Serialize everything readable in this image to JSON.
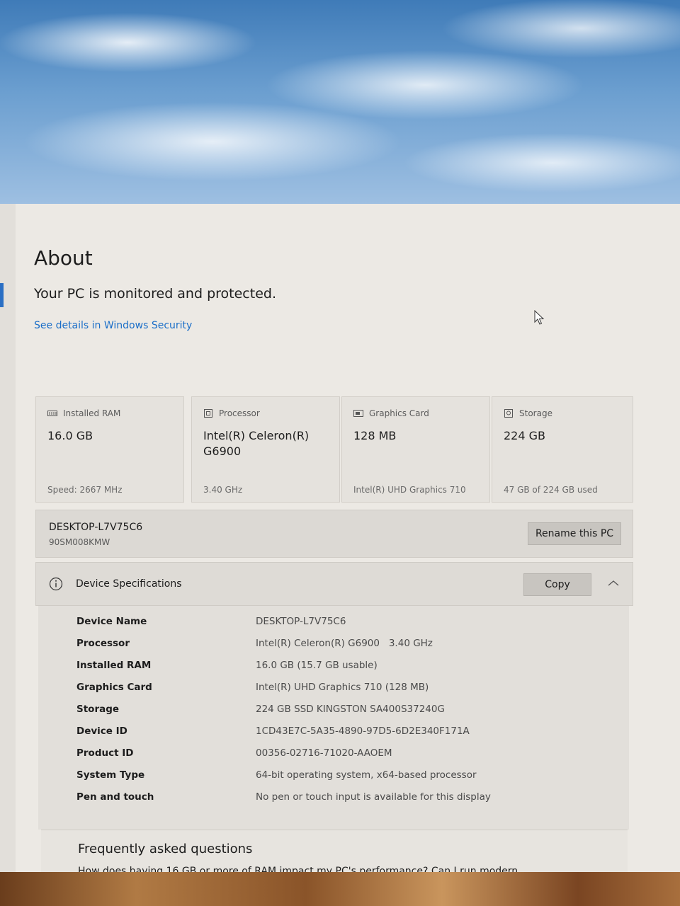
{
  "page": {
    "title": "About",
    "protection_status": "Your PC is monitored and protected.",
    "security_link": "See details in Windows Security"
  },
  "tiles": [
    {
      "label": "Installed RAM",
      "value": "16.0 GB",
      "footer": "Speed: 2667 MHz",
      "icon": "ram-icon"
    },
    {
      "label": "Processor",
      "value": "Intel(R) Celeron(R) G6900",
      "footer": "3.40 GHz",
      "icon": "processor-icon"
    },
    {
      "label": "Graphics Card",
      "value": "128 MB",
      "footer": "Intel(R) UHD Graphics 710",
      "icon": "graphics-card-icon"
    },
    {
      "label": "Storage",
      "value": "224 GB",
      "footer": "47 GB of 224 GB used",
      "icon": "storage-icon"
    }
  ],
  "pc": {
    "name": "DESKTOP-L7V75C6",
    "model": "90SM008KMW",
    "rename_label": "Rename this PC"
  },
  "specs": {
    "title": "Device Specifications",
    "copy_label": "Copy",
    "rows": [
      {
        "label": "Device Name",
        "value": "DESKTOP-L7V75C6"
      },
      {
        "label": "Processor",
        "value": "Intel(R) Celeron(R) G6900   3.40 GHz"
      },
      {
        "label": "Installed RAM",
        "value": "16.0 GB (15.7 GB usable)"
      },
      {
        "label": "Graphics Card",
        "value": "Intel(R) UHD Graphics 710 (128 MB)"
      },
      {
        "label": "Storage",
        "value": "224 GB SSD KINGSTON SA400S37240G"
      },
      {
        "label": "Device ID",
        "value": "1CD43E7C-5A35-4890-97D5-6D2E340F171A"
      },
      {
        "label": "Product ID",
        "value": "00356-02716-71020-AAOEM"
      },
      {
        "label": "System Type",
        "value": "64-bit operating system, x64-based processor"
      },
      {
        "label": "Pen and touch",
        "value": "No pen or touch input is available for this display"
      }
    ]
  },
  "faq": {
    "title": "Frequently asked questions",
    "question": "How does having 16 GB or more of RAM impact my PC's performance? Can I run modern"
  },
  "colors": {
    "accent": "#1a6ec8",
    "window_bg": "#ece9e4"
  }
}
